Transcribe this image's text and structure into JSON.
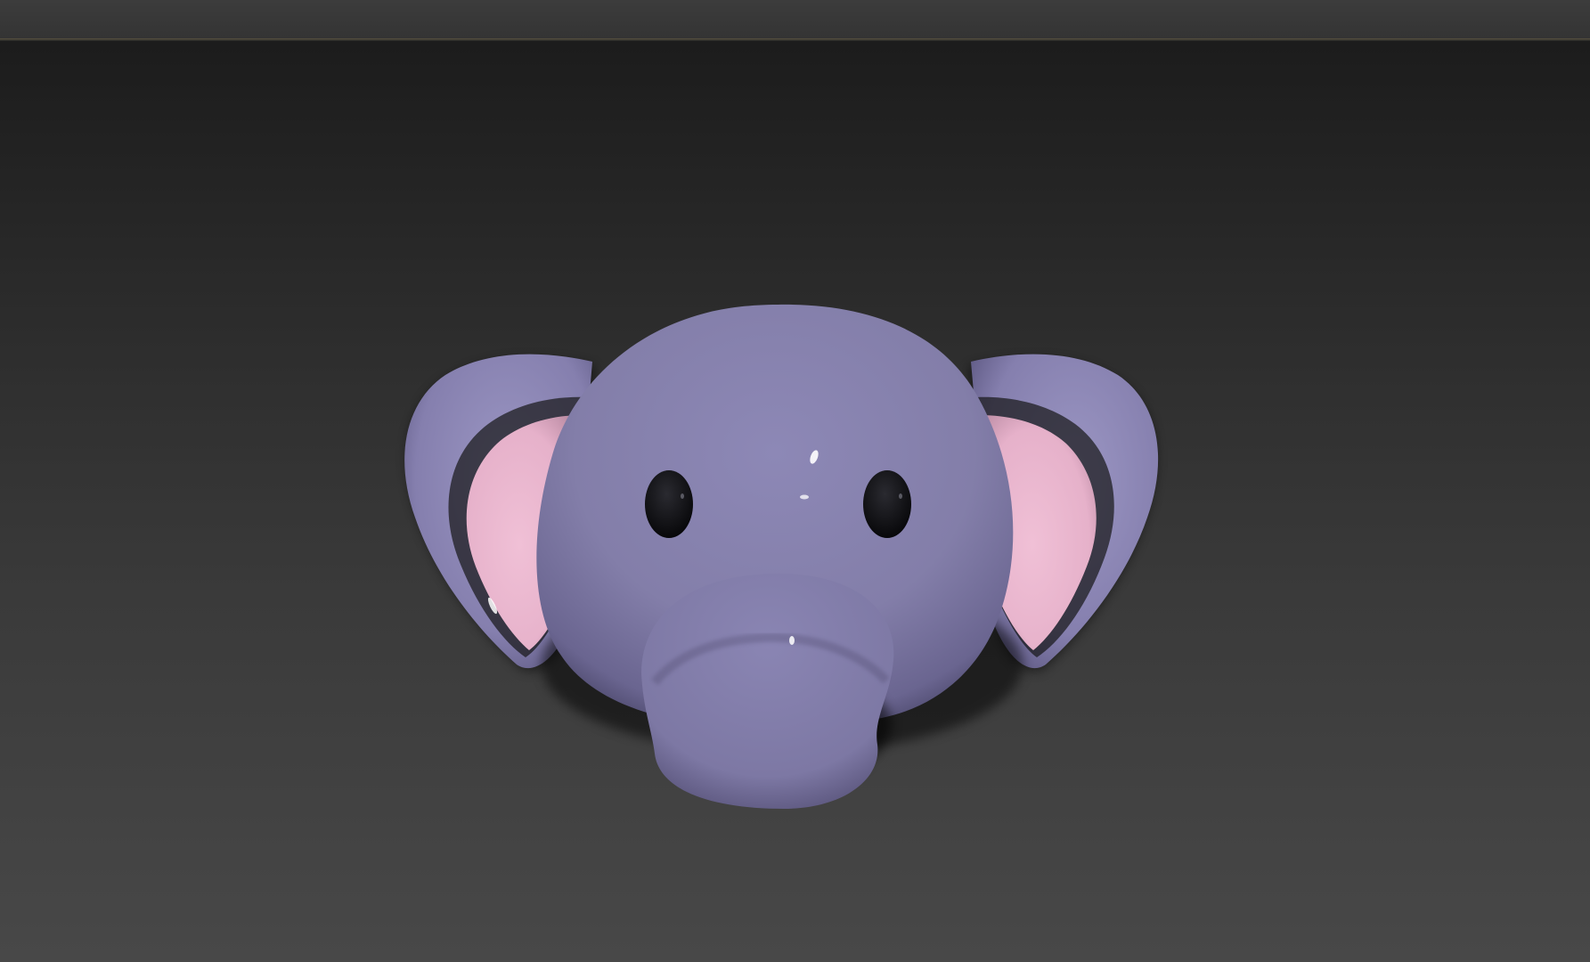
{
  "viewport": {
    "model": "elephant-head",
    "colors": {
      "background_top": "#1c1c1c",
      "background_bottom": "#484848",
      "skin": "#8b86b4",
      "skin_shadow": "#4e4a6e",
      "inner_ear": "#eab7cf",
      "eyes": "#0d0d0f"
    }
  }
}
